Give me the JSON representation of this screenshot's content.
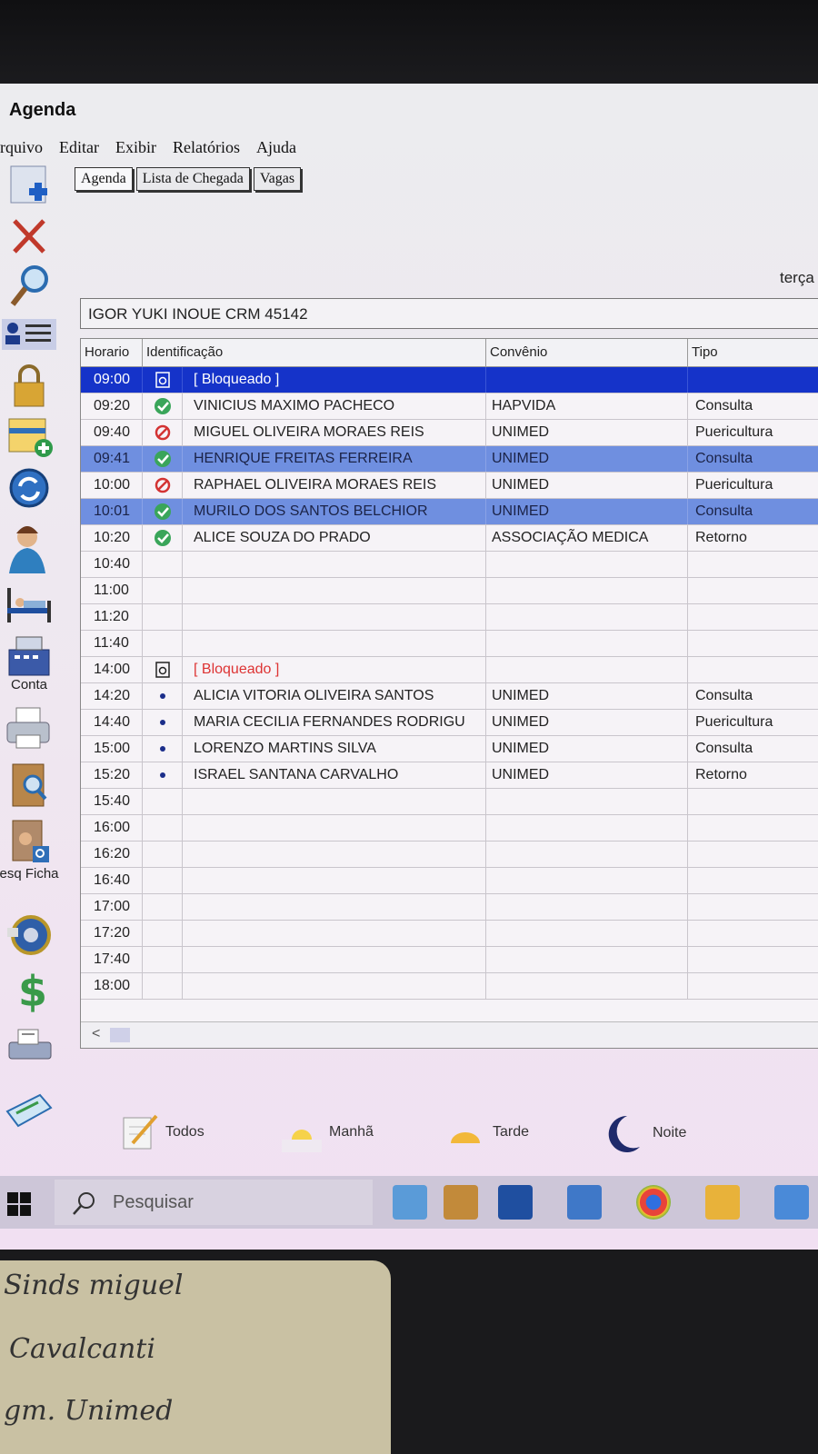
{
  "window": {
    "title": "Agenda",
    "date_partial": "terça"
  },
  "menu": [
    "rquivo",
    "Editar",
    "Exibir",
    "Relatórios",
    "Ajuda"
  ],
  "tabs": [
    "Agenda",
    "Lista de Chegada",
    "Vagas"
  ],
  "toolbar": {
    "conta_label": "Conta",
    "pesq_ficha_label": "Pesq Ficha"
  },
  "doctor": "IGOR YUKI INOUE CRM 45142",
  "columns": [
    "Horario",
    "Identificação",
    "Convênio",
    "Tipo"
  ],
  "rows": [
    {
      "time": "09:00",
      "icon": "lock",
      "name": "[ Bloqueado ]",
      "conv": "",
      "tipo": "",
      "style": "sel-dark",
      "blocked": true
    },
    {
      "time": "09:20",
      "icon": "check",
      "name": "VINICIUS MAXIMO PACHECO",
      "conv": "HAPVIDA",
      "tipo": "Consulta"
    },
    {
      "time": "09:40",
      "icon": "no",
      "name": "MIGUEL OLIVEIRA MORAES REIS",
      "conv": "UNIMED",
      "tipo": "Puericultura"
    },
    {
      "time": "09:41",
      "icon": "check",
      "name": "HENRIQUE FREITAS FERREIRA",
      "conv": "UNIMED",
      "tipo": "Consulta",
      "style": "sel-light"
    },
    {
      "time": "10:00",
      "icon": "no",
      "name": "RAPHAEL OLIVEIRA MORAES REIS",
      "conv": "UNIMED",
      "tipo": "Puericultura"
    },
    {
      "time": "10:01",
      "icon": "check",
      "name": "MURILO DOS SANTOS BELCHIOR",
      "conv": "UNIMED",
      "tipo": "Consulta",
      "style": "sel-light"
    },
    {
      "time": "10:20",
      "icon": "check",
      "name": "ALICE SOUZA DO PRADO",
      "conv": "ASSOCIAÇÃO MEDICA",
      "tipo": "Retorno"
    },
    {
      "time": "10:40",
      "icon": "",
      "name": "",
      "conv": "",
      "tipo": ""
    },
    {
      "time": "11:00",
      "icon": "",
      "name": "",
      "conv": "",
      "tipo": ""
    },
    {
      "time": "11:20",
      "icon": "",
      "name": "",
      "conv": "",
      "tipo": ""
    },
    {
      "time": "11:40",
      "icon": "",
      "name": "",
      "conv": "",
      "tipo": ""
    },
    {
      "time": "14:00",
      "icon": "lock",
      "name": "[ Bloqueado ]",
      "conv": "",
      "tipo": "",
      "blocked": true
    },
    {
      "time": "14:20",
      "icon": "dot",
      "name": "ALICIA VITORIA OLIVEIRA SANTOS",
      "conv": "UNIMED",
      "tipo": "Consulta"
    },
    {
      "time": "14:40",
      "icon": "dot",
      "name": "MARIA CECILIA FERNANDES RODRIGU",
      "conv": "UNIMED",
      "tipo": "Puericultura"
    },
    {
      "time": "15:00",
      "icon": "dot",
      "name": "LORENZO MARTINS SILVA",
      "conv": "UNIMED",
      "tipo": "Consulta"
    },
    {
      "time": "15:20",
      "icon": "dot",
      "name": "ISRAEL SANTANA CARVALHO",
      "conv": "UNIMED",
      "tipo": "Retorno"
    },
    {
      "time": "15:40",
      "icon": "",
      "name": "",
      "conv": "",
      "tipo": ""
    },
    {
      "time": "16:00",
      "icon": "",
      "name": "",
      "conv": "",
      "tipo": ""
    },
    {
      "time": "16:20",
      "icon": "",
      "name": "",
      "conv": "",
      "tipo": ""
    },
    {
      "time": "16:40",
      "icon": "",
      "name": "",
      "conv": "",
      "tipo": ""
    },
    {
      "time": "17:00",
      "icon": "",
      "name": "",
      "conv": "",
      "tipo": ""
    },
    {
      "time": "17:20",
      "icon": "",
      "name": "",
      "conv": "",
      "tipo": ""
    },
    {
      "time": "17:40",
      "icon": "",
      "name": "",
      "conv": "",
      "tipo": ""
    },
    {
      "time": "18:00",
      "icon": "",
      "name": "",
      "conv": "",
      "tipo": ""
    }
  ],
  "scroll_arrow": "<",
  "filters": {
    "todos": "Todos",
    "manha": "Manhã",
    "tarde": "Tarde",
    "noite": "Noite"
  },
  "taskbar": {
    "search_placeholder": "Pesquisar"
  },
  "colors": {
    "selected_dark": "#1533c9",
    "selected_light": "#6f8fe0",
    "check_green": "#3aa55a",
    "blocked_red": "#d33333"
  },
  "note": {
    "line1": "Sinds miguel",
    "line2": "Cavalcanti",
    "line3": "gm. Unimed"
  }
}
